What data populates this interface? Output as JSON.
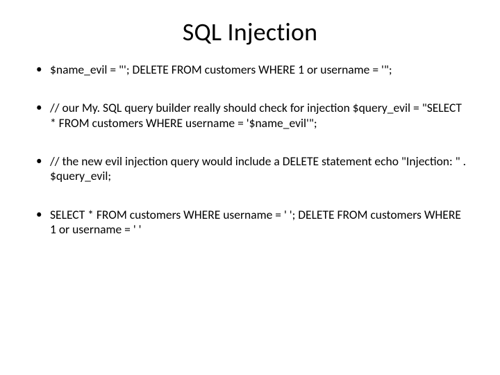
{
  "title": "SQL Injection",
  "bullets": [
    "$name_evil = \"'; DELETE FROM customers WHERE 1 or username = '\";",
    "// our My. SQL query builder really should check for injection $query_evil = \"SELECT * FROM customers WHERE username = '$name_evil'\";",
    "// the new evil injection query would include a DELETE statement echo \"Injection: \" . $query_evil;",
    "SELECT * FROM customers WHERE username = ' '; DELETE FROM customers WHERE 1 or username = ' '"
  ]
}
